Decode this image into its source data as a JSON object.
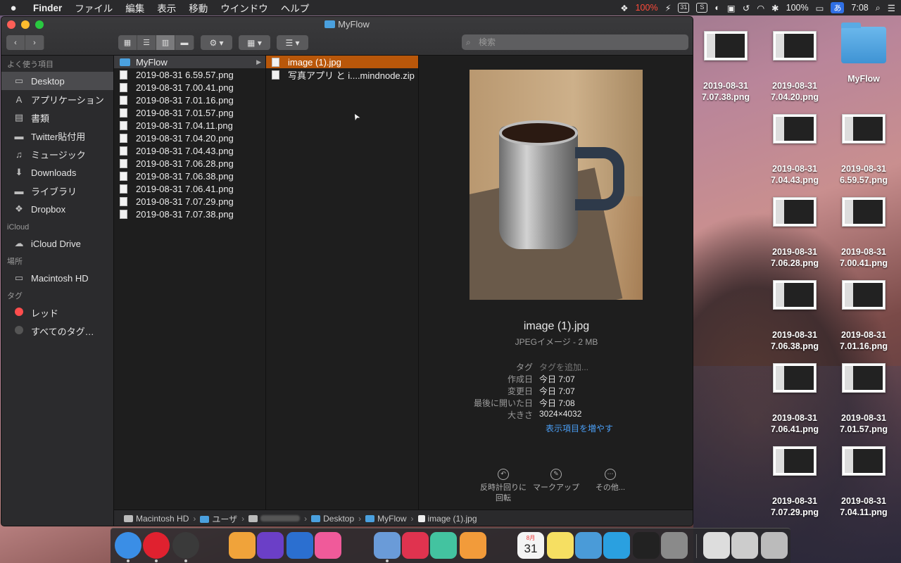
{
  "menubar": {
    "apple": "",
    "app": "Finder",
    "items": [
      "ファイル",
      "編集",
      "表示",
      "移動",
      "ウインドウ",
      "ヘルプ"
    ],
    "battery_app": "100%",
    "calendar_day": "31",
    "battery": "100%",
    "input_method": "あ",
    "clock": "7:08"
  },
  "window": {
    "title": "MyFlow",
    "search_placeholder": "検索"
  },
  "sidebar": {
    "sections": [
      {
        "header": "よく使う項目",
        "items": [
          {
            "label": "Desktop",
            "icon": "desktop-icon",
            "glyph": "▭",
            "selected": true
          },
          {
            "label": "アプリケーション",
            "icon": "applications-icon",
            "glyph": "A"
          },
          {
            "label": "書類",
            "icon": "documents-icon",
            "glyph": "▤"
          },
          {
            "label": "Twitter貼付用",
            "icon": "folder-icon",
            "glyph": "▬"
          },
          {
            "label": "ミュージック",
            "icon": "music-icon",
            "glyph": "♫"
          },
          {
            "label": "Downloads",
            "icon": "downloads-icon",
            "glyph": "⬇"
          },
          {
            "label": "ライブラリ",
            "icon": "folder-icon",
            "glyph": "▬"
          },
          {
            "label": "Dropbox",
            "icon": "dropbox-icon",
            "glyph": "❖"
          }
        ]
      },
      {
        "header": "iCloud",
        "items": [
          {
            "label": "iCloud Drive",
            "icon": "cloud-icon",
            "glyph": "☁"
          }
        ]
      },
      {
        "header": "場所",
        "items": [
          {
            "label": "Macintosh HD",
            "icon": "harddisk-icon",
            "glyph": "▭"
          }
        ]
      },
      {
        "header": "タグ",
        "items": [
          {
            "label": "レッド",
            "icon": "tag-red-icon",
            "color": "#ff4d4d"
          },
          {
            "label": "すべてのタグ…",
            "icon": "tag-all-icon",
            "color": "#555555"
          }
        ]
      }
    ]
  },
  "column1": {
    "folder": "MyFlow",
    "files": [
      "2019-08-31 6.59.57.png",
      "2019-08-31 7.00.41.png",
      "2019-08-31 7.01.16.png",
      "2019-08-31 7.01.57.png",
      "2019-08-31 7.04.11.png",
      "2019-08-31 7.04.20.png",
      "2019-08-31 7.04.43.png",
      "2019-08-31 7.06.28.png",
      "2019-08-31 7.06.38.png",
      "2019-08-31 7.06.41.png",
      "2019-08-31 7.07.29.png",
      "2019-08-31 7.07.38.png"
    ]
  },
  "column2": {
    "files": [
      "image (1).jpg",
      "写真アプリ と i....mindnode.zip"
    ]
  },
  "preview": {
    "name": "image (1).jpg",
    "kind": "JPEGイメージ - 2 MB",
    "meta": [
      {
        "k": "タグ",
        "v": "タグを追加...",
        "placeholder": true
      },
      {
        "k": "作成日",
        "v": "今日 7:07"
      },
      {
        "k": "変更日",
        "v": "今日 7:07"
      },
      {
        "k": "最後に開いた日",
        "v": "今日 7:08"
      },
      {
        "k": "大きさ",
        "v": "3024×4032"
      }
    ],
    "show_more": "表示項目を増やす",
    "actions": [
      {
        "label": "反時計回りに\n回転",
        "icon": "rotate-left-icon"
      },
      {
        "label": "マークアップ",
        "icon": "markup-icon"
      },
      {
        "label": "その他...",
        "icon": "more-icon"
      }
    ]
  },
  "pathbar": [
    "Macintosh HD",
    "ユーザ",
    "",
    "Desktop",
    "MyFlow",
    "image (1).jpg"
  ],
  "desktop": {
    "icons": [
      {
        "label": "2019-08-31\n7.07.38.png",
        "type": "png"
      },
      {
        "label": "2019-08-31\n7.04.20.png",
        "type": "png"
      },
      {
        "label": "MyFlow",
        "type": "folder"
      },
      {
        "label": "2019-08-31\n7.04.43.png",
        "type": "png"
      },
      {
        "label": "2019-08-31\n6.59.57.png",
        "type": "png"
      },
      {
        "label": "2019-08-31\n7.06.28.png",
        "type": "png"
      },
      {
        "label": "2019-08-31\n7.00.41.png",
        "type": "png"
      },
      {
        "label": "2019-08-31\n7.06.38.png",
        "type": "png"
      },
      {
        "label": "2019-08-31\n7.01.16.png",
        "type": "png"
      },
      {
        "label": "2019-08-31\n7.06.41.png",
        "type": "png"
      },
      {
        "label": "2019-08-31\n7.01.57.png",
        "type": "png"
      },
      {
        "label": "2019-08-31\n7.07.29.png",
        "type": "png"
      },
      {
        "label": "2019-08-31\n7.04.11.png",
        "type": "png"
      }
    ]
  },
  "dock": {
    "apps": [
      {
        "name": "finder-icon",
        "color": "#3a8ee6"
      },
      {
        "name": "opera-icon",
        "color": "#e0212f"
      },
      {
        "name": "vivaldi-icon",
        "color": "#3a3a3a"
      },
      {
        "name": "photos-icon",
        "color": "#f0a33a"
      },
      {
        "name": "imovie-icon",
        "color": "#6b3fc7"
      },
      {
        "name": "quicktime-icon",
        "color": "#2b6fd0"
      },
      {
        "name": "itunes-icon",
        "color": "#f05a9a"
      },
      {
        "name": "preview-icon",
        "color": "#6a9bd8"
      },
      {
        "name": "pocket-icon",
        "color": "#e0334f"
      },
      {
        "name": "colorsync-icon",
        "color": "#43c3a0"
      },
      {
        "name": "pages-icon",
        "color": "#f29b3a"
      },
      {
        "name": "calendar-icon",
        "color": "#f4f4f4"
      },
      {
        "name": "notes-icon",
        "color": "#f6df62"
      },
      {
        "name": "script-icon",
        "color": "#4a9bd8"
      },
      {
        "name": "airdrop-icon",
        "color": "#2aa0e0"
      },
      {
        "name": "activity-monitor-icon",
        "color": "#222222"
      },
      {
        "name": "system-preferences-icon",
        "color": "#8a8a8a"
      },
      {
        "name": "documents-stack-icon",
        "color": "#dddddd"
      },
      {
        "name": "music-stack-icon",
        "color": "#cccccc"
      },
      {
        "name": "trash-icon",
        "color": "#bbbbbb"
      }
    ],
    "calendar_day": "31",
    "calendar_month": "8月"
  }
}
